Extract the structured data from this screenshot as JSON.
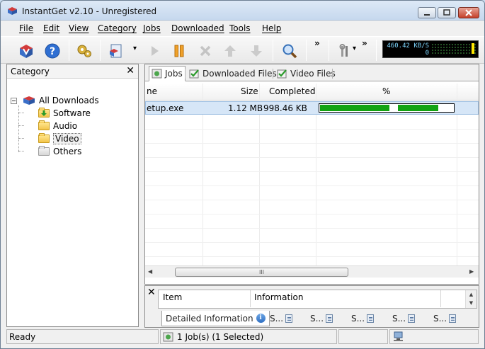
{
  "window": {
    "title": "InstantGet v2.10 - Unregistered"
  },
  "menu": {
    "items": [
      "File",
      "Edit",
      "View",
      "Category",
      "Jobs",
      "Downloaded",
      "Tools",
      "Help"
    ]
  },
  "toolbar": {
    "icons": [
      "add-url-icon",
      "help-icon",
      "settings-gears-icon",
      "new-download-icon",
      "start-icon",
      "pause-icon",
      "delete-icon",
      "move-up-icon",
      "move-down-icon",
      "search-icon",
      "tools-icon"
    ],
    "overflow_1": "»",
    "overflow_2": "»",
    "dropdown_arrow": "▾",
    "speed_value": "460.42 KB/S",
    "speed_secondary": "0"
  },
  "category_panel": {
    "title": "Category",
    "close": "✕",
    "root": "All Downloads",
    "children": [
      "Software",
      "Audio",
      "Video",
      "Others"
    ],
    "selected": "Video"
  },
  "tabs": {
    "items": [
      "Jobs",
      "Downloaded Files",
      "Video Files"
    ],
    "active": "Jobs"
  },
  "grid": {
    "columns": [
      "ne",
      "Size",
      "Completed",
      "%"
    ],
    "rows": [
      {
        "name": "etup.exe",
        "size": "1.12 MB",
        "completed": "998.46 KB",
        "progress": 0.89
      }
    ],
    "scroll_left": "◀",
    "scroll_right": "▶",
    "scroll_grip": "III"
  },
  "details_panel": {
    "close": "✕",
    "columns": [
      "Item",
      "Information"
    ],
    "scroll_up": "▲",
    "scroll_down": "▼",
    "tabs": [
      "Detailed Information",
      "S...",
      "S...",
      "S...",
      "S...",
      "S..."
    ]
  },
  "status": {
    "ready": "Ready",
    "jobs": "1 Job(s) (1 Selected)"
  },
  "colors": {
    "progress_fill": "#13a313",
    "selection": "#d6e6f7",
    "title_bg": "#c6d8ee"
  }
}
